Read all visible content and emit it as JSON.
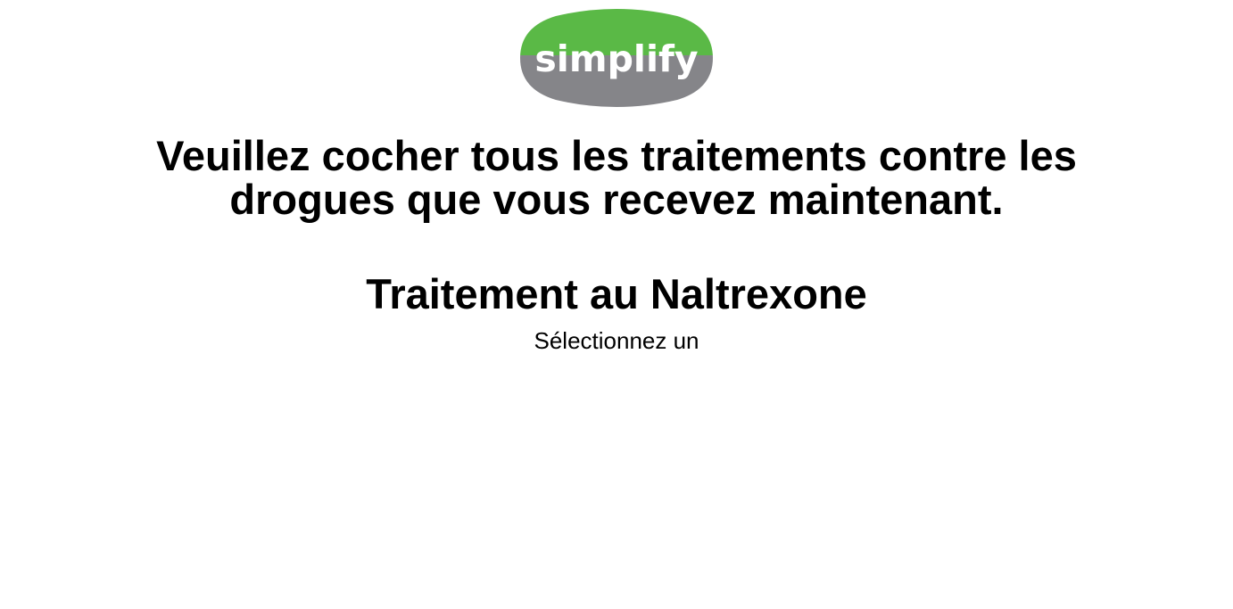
{
  "logo": {
    "text": "simplify",
    "colors": {
      "top": "#5ab946",
      "bottom": "#858589",
      "text": "#ffffff"
    }
  },
  "question": {
    "line1": "Veuillez cocher tous les traitements contre les",
    "line2": "drogues que vous recevez maintenant."
  },
  "section": {
    "title": "Traitement au Naltrexone",
    "prompt": "Sélectionnez un"
  }
}
